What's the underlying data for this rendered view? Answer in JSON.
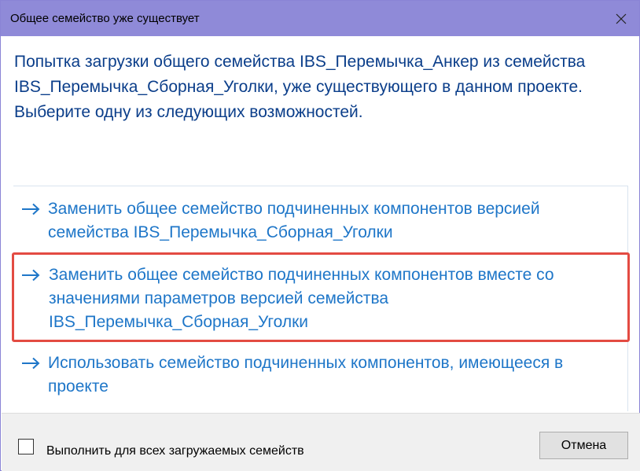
{
  "window": {
    "title": "Общее семейство уже существует",
    "accent_color": "#8f8ad8",
    "close_icon": "close-icon"
  },
  "instruction": {
    "lines": [
      "Попытка загрузки общего семейства IBS_Перемычка_Анкер из семейства",
      "IBS_Перемычка_Сборная_Уголки, уже существующего в данном проекте.  Выберите одну из следующих возможностей."
    ]
  },
  "commands": [
    {
      "icon": "arrow-right-icon",
      "label": "Заменить общее семейство подчиненных компонентов версией семейства IBS_Перемычка_Сборная_Уголки"
    },
    {
      "icon": "arrow-right-icon",
      "label": "Заменить общее семейство подчиненных компонентов вместе со значениями параметров версией семейства IBS_Перемычка_Сборная_Уголки",
      "highlight_color": "#e34b42"
    },
    {
      "icon": "arrow-right-icon",
      "label": "Использовать семейство подчиненных компонентов, имеющееся в проекте"
    }
  ],
  "footer": {
    "checkbox_label": "Выполнить для всех загружаемых семейств",
    "checkbox_checked": false,
    "cancel_label": "Отмена"
  },
  "colors": {
    "instruction_text": "#0b3e8a",
    "command_text": "#1e76c8"
  }
}
